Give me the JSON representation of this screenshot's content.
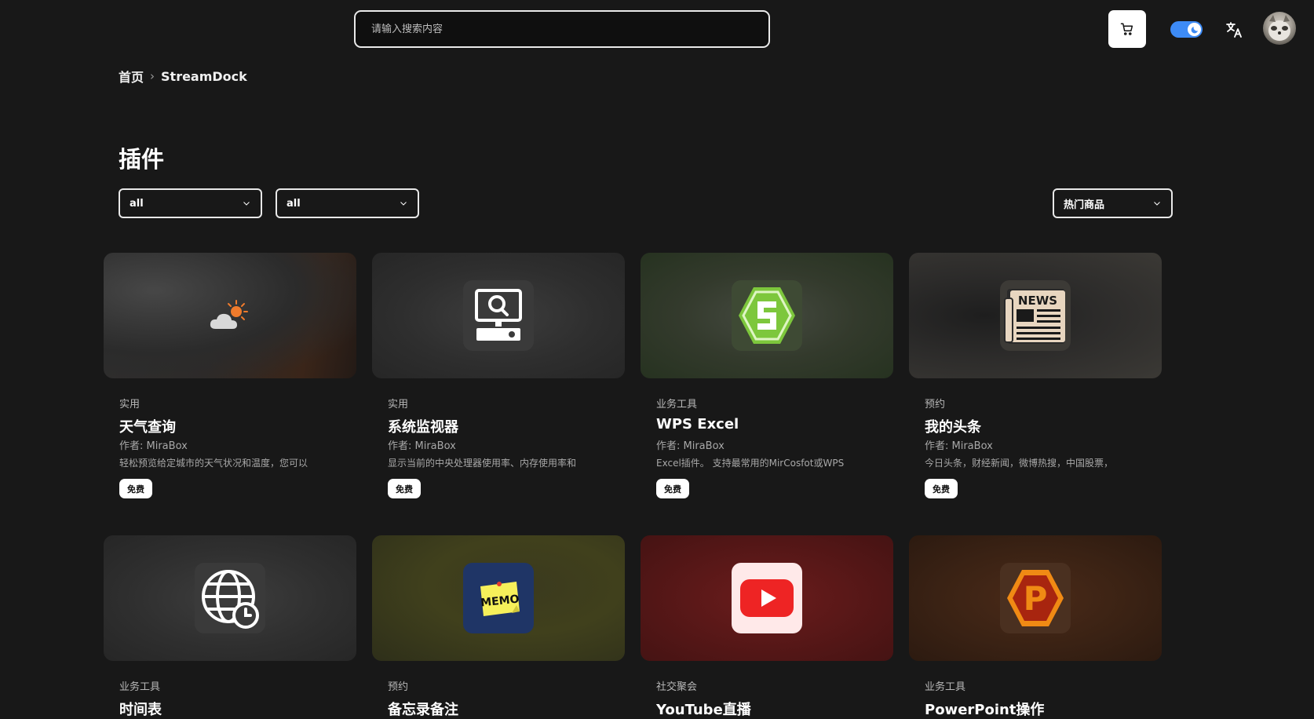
{
  "header": {
    "search_placeholder": "请输入搜索内容",
    "icons": {
      "cart": "cart-icon",
      "theme": "moon-icon",
      "language": "translate-icon",
      "avatar": "avatar"
    }
  },
  "breadcrumb": {
    "home": "首页",
    "current": "StreamDock"
  },
  "page": {
    "title": "插件"
  },
  "filters": {
    "filter1": "all",
    "filter2": "all",
    "sort": "热门商品"
  },
  "cards": [
    {
      "category": "实用",
      "name": "天气查询",
      "author": "作者: MiraBox",
      "desc": "轻松预览给定城市的天气状况和温度，您可以",
      "price": "免费",
      "icon": "weather-icon"
    },
    {
      "category": "实用",
      "name": "系统监视器",
      "author": "作者: MiraBox",
      "desc": "显示当前的中央处理器使用率、内存使用率和",
      "price": "免费",
      "icon": "system-monitor-icon"
    },
    {
      "category": "业务工具",
      "name": "WPS Excel",
      "author": "作者: MiraBox",
      "desc": "Excel插件。 支持最常用的MirCosfot或WPS",
      "price": "免费",
      "icon": "wps-excel-icon"
    },
    {
      "category": "预约",
      "name": "我的头条",
      "author": "作者: MiraBox",
      "desc": "今日头条，财经新闻，微博热搜，中国股票，",
      "price": "免费",
      "icon": "news-icon"
    },
    {
      "category": "业务工具",
      "name": "时间表",
      "icon": "globe-clock-icon"
    },
    {
      "category": "预约",
      "name": "备忘录备注",
      "icon": "memo-icon"
    },
    {
      "category": "社交聚会",
      "name": "YouTube直播",
      "icon": "youtube-icon"
    },
    {
      "category": "业务工具",
      "name": "PowerPoint操作",
      "icon": "powerpoint-icon"
    }
  ],
  "news_label": "NEWS",
  "memo_label": "MEMO",
  "ppt_letter": "P"
}
